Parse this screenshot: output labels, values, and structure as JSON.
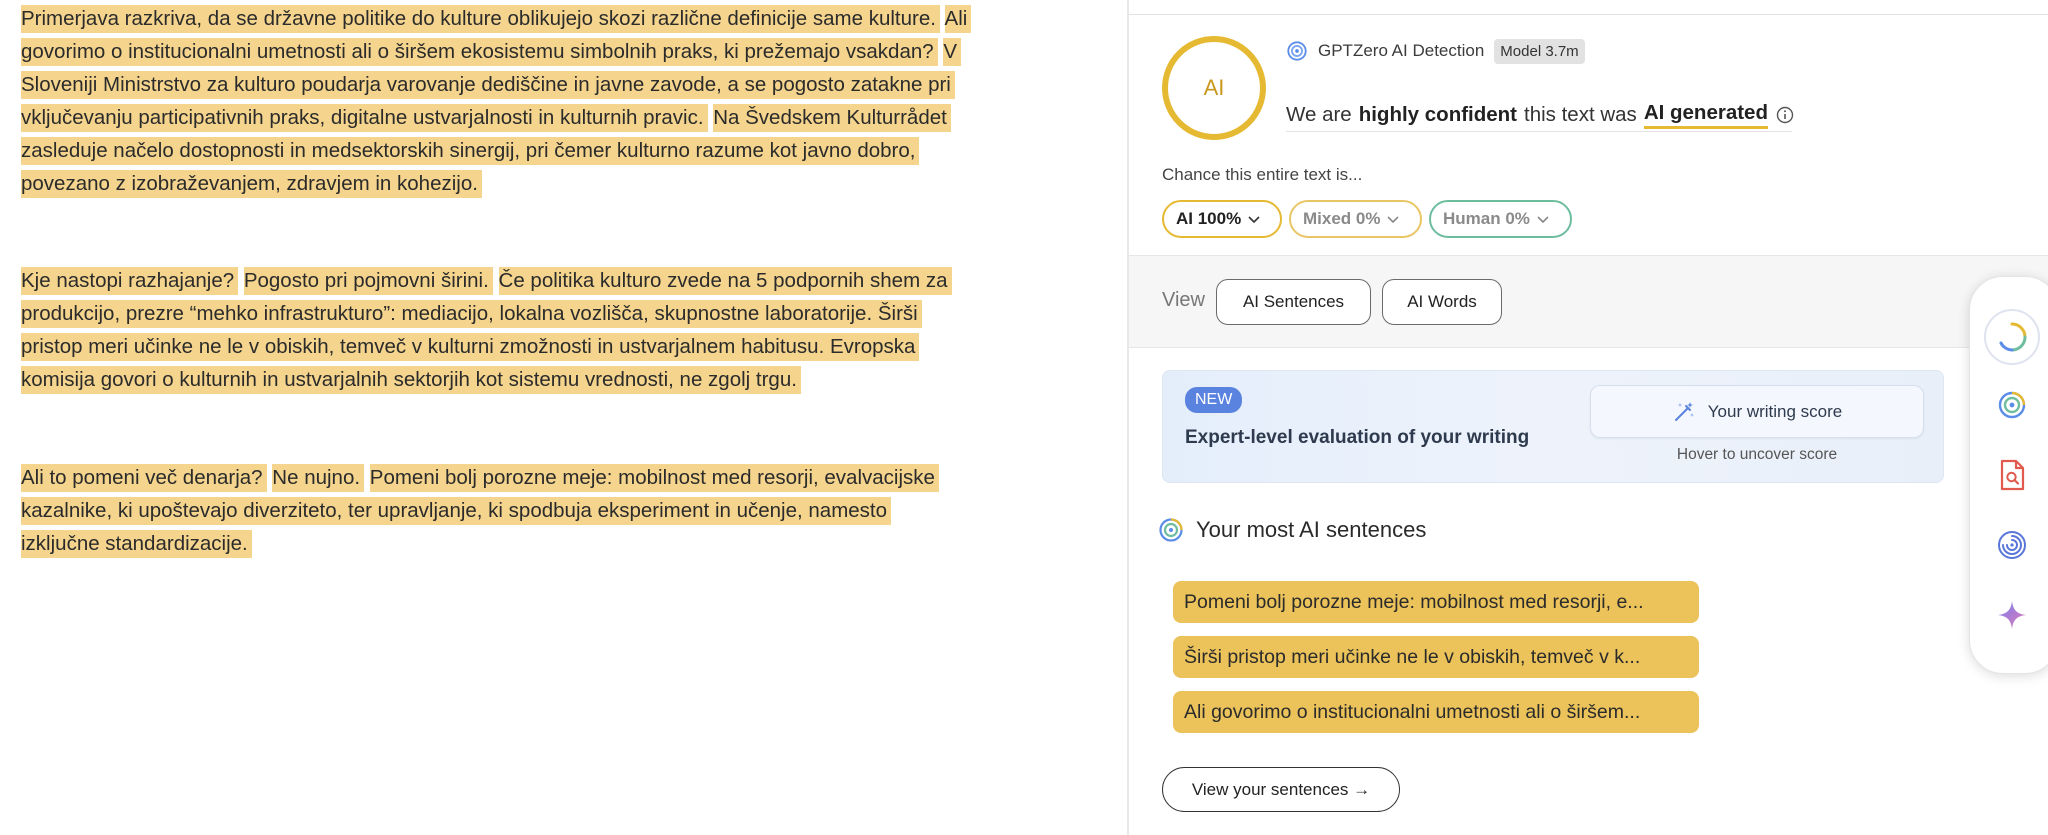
{
  "document": {
    "paragraphs": [
      [
        "Primerjava razkriva, da se državne politike do kulture oblikujejo skozi različne definicije same kulture.",
        "Ali govorimo o institucionalni umetnosti ali o širšem ekosistemu simbolnih praks, ki prežemajo vsakdan?",
        "V Sloveniji Ministrstvo za kulturo poudarja varovanje dediščine in javne zavode, a se pogosto zatakne pri vključevanju participativnih praks, digitalne ustvarjalnosti in kulturnih pravic.",
        "Na Švedskem Kulturrådet zasleduje načelo dostopnosti in medsektorskih sinergij, pri čemer kulturno razume kot javno dobro, povezano z izobraževanjem, zdravjem in kohezijo."
      ],
      [
        "Kje nastopi razhajanje?",
        "Pogosto pri pojmovni širini.",
        "Če politika kulturo zvede na 5 podpornih shem za produkcijo, prezre “mehko infrastrukturo”: mediacijo, lokalna vozlišča, skupnostne laboratorije. Širši pristop meri učinke ne le v obiskih, temveč v kulturni zmožnosti in ustvarjalnem habitusu. Evropska komisija govori o kulturnih in ustvarjalnih sektorjih kot sistemu vrednosti, ne zgolj trgu."
      ],
      [
        "Ali to pomeni več denarja?",
        "Ne nujno.",
        "Pomeni bolj porozne meje: mobilnost med resorji, evalvacijske kazalnike, ki upoštevajo diverziteto, ter upravljanje, ki spodbuja eksperiment in učenje, namesto izključne standardizacije."
      ]
    ]
  },
  "detector": {
    "ring_label": "AI",
    "name": "GPTZero AI Detection",
    "model": "Model 3.7m",
    "headline_pre": "We are",
    "headline_bold": "highly confident",
    "headline_mid": "this text was",
    "headline_result": "AI generated",
    "chance_label": "Chance this entire text is...",
    "pills": {
      "ai": "AI 100%",
      "mixed": "Mixed 0%",
      "human": "Human 0%"
    },
    "colors": {
      "ai": "#e6b933",
      "mixed": "#e8c565",
      "human": "#6ebd9f"
    }
  },
  "view": {
    "label": "View",
    "sentences_btn": "AI Sentences",
    "words_btn": "AI Words"
  },
  "promo": {
    "badge": "NEW",
    "title": "Expert-level evaluation of your writing",
    "score_btn": "Your writing score",
    "hover_text": "Hover to uncover score"
  },
  "most_ai": {
    "title": "Your most AI sentences",
    "sentences": [
      "Pomeni bolj porozne meje: mobilnost med resorji, e...",
      "Širši pristop meri učinke ne le v obiskih, temveč v k...",
      "Ali govorimo o institucionalni umetnosti ali o širšem..."
    ],
    "view_btn": "View your sentences →"
  },
  "sidebar": {
    "icons": [
      "loading-ring-icon",
      "gptzero-logo-icon",
      "document-search-icon",
      "fingerprint-icon",
      "sparkle-icon"
    ]
  }
}
